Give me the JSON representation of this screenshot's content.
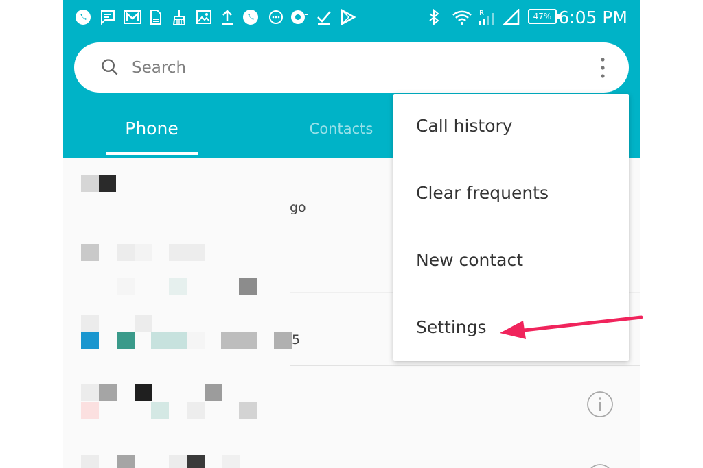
{
  "status_bar": {
    "icons": [
      "whatsapp-icon",
      "message-icon",
      "gmail-icon",
      "file-icon",
      "broom-icon",
      "image-icon",
      "upload-icon",
      "whatsapp-icon",
      "chat-bubble-icon",
      "sync-icon",
      "check-icon",
      "play-store-icon",
      "bluetooth-icon",
      "wifi-icon",
      "signal-r-icon",
      "signal-icon",
      "battery-icon"
    ],
    "battery": "47%",
    "time": "6:05 PM"
  },
  "search": {
    "placeholder": "Search",
    "icon": "search-icon",
    "more_icon": "more-vert-icon"
  },
  "tabs": [
    {
      "label": "Phone",
      "active": true
    },
    {
      "label": "Contacts",
      "active": false
    }
  ],
  "list": {
    "fragments": [
      "go",
      "5"
    ],
    "info_icon": "info-icon"
  },
  "menu": {
    "items": [
      {
        "label": "Call history"
      },
      {
        "label": "Clear frequents"
      },
      {
        "label": "New contact"
      },
      {
        "label": "Settings"
      }
    ]
  },
  "annotation": {
    "arrow_color": "#f0245c"
  },
  "colors": {
    "header": "#00b3c7",
    "accent": "#f0245c"
  }
}
